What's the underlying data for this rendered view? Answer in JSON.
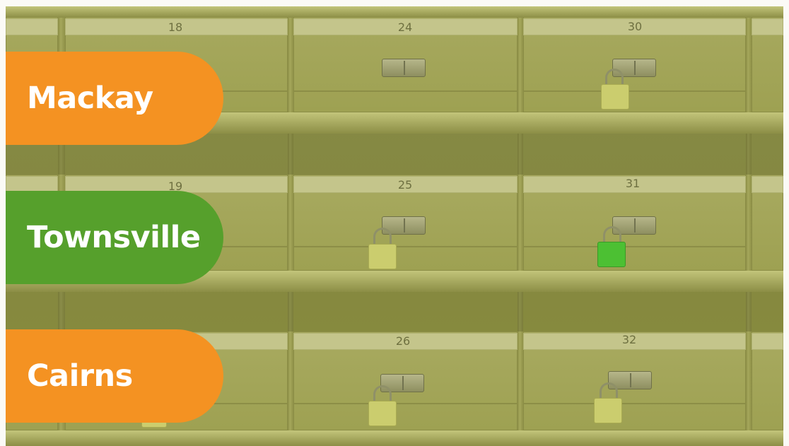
{
  "banners": [
    {
      "label": "Mackay",
      "color": "#f49222"
    },
    {
      "label": "Townsville",
      "color": "#56a02c"
    },
    {
      "label": "Cairns",
      "color": "#f49222"
    }
  ],
  "mailboxes": {
    "numbers": [
      "18",
      "24",
      "30",
      "19",
      "25",
      "31",
      "26",
      "32"
    ]
  },
  "padlock_colors": {
    "yellow": "#cbcd6e",
    "green": "#4cc033"
  }
}
